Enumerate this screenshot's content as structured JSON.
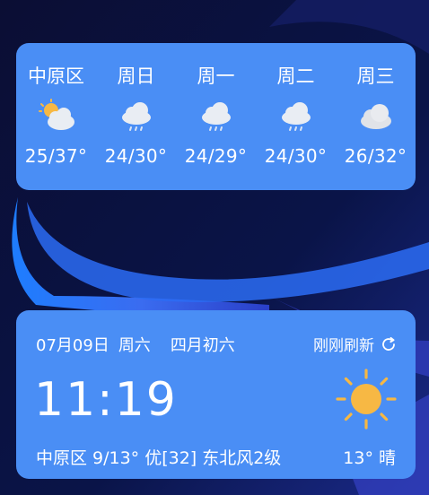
{
  "forecast": {
    "days": [
      {
        "label": "中原区",
        "temp": "25/37°",
        "icon": "partly-cloudy-icon"
      },
      {
        "label": "周日",
        "temp": "24/30°",
        "icon": "light-rain-icon"
      },
      {
        "label": "周一",
        "temp": "24/29°",
        "icon": "light-rain-icon"
      },
      {
        "label": "周二",
        "temp": "24/30°",
        "icon": "light-rain-icon"
      },
      {
        "label": "周三",
        "temp": "26/32°",
        "icon": "cloudy-icon"
      }
    ]
  },
  "clock": {
    "date": "07月09日",
    "weekday": "周六",
    "lunar": "四月初六",
    "refresh_label": "刚刚刷新",
    "time": "11:19",
    "location": "中原区",
    "temp_range": "9/13°",
    "aqi": "优[32]",
    "wind": "东北风2级",
    "current_temp": "13°",
    "condition": "晴",
    "condition_icon": "sun-icon"
  },
  "colors": {
    "card": "#4a8ef5",
    "sun": "#f7b844",
    "wallpaper_dark": "#0a0f3a"
  }
}
